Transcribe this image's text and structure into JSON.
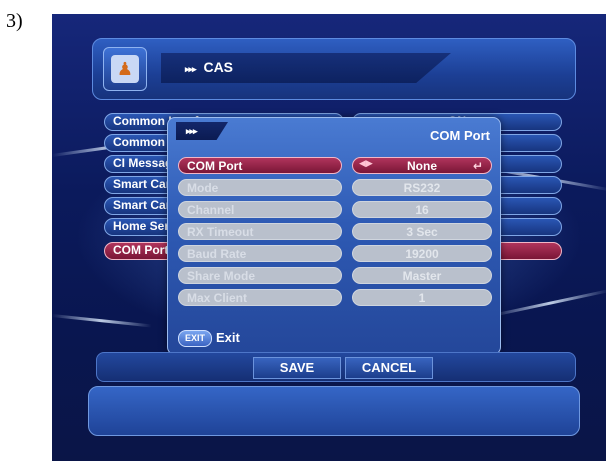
{
  "step_label": "3)",
  "header": {
    "arrows": "▸▸▸",
    "title": "CAS",
    "icon": "user-menu-icon"
  },
  "menu": {
    "items": [
      {
        "label": "Common Interface",
        "value": "ON"
      },
      {
        "label": "Common Interface",
        "value": ""
      },
      {
        "label": "CI Message",
        "value": ""
      },
      {
        "label": "Smart Card",
        "value": ""
      },
      {
        "label": "Smart Card",
        "value": ""
      },
      {
        "label": "Home Service",
        "value": ""
      },
      {
        "label": "COM Port",
        "value": ""
      }
    ]
  },
  "dialog": {
    "tab_arrows": "▸▸▸",
    "title": "COM Port",
    "rows": [
      {
        "label": "COM Port",
        "value": "None",
        "selected": true
      },
      {
        "label": "Mode",
        "value": "RS232"
      },
      {
        "label": "Channel",
        "value": "16"
      },
      {
        "label": "RX Timeout",
        "value": "3 Sec"
      },
      {
        "label": "Baud Rate",
        "value": "19200"
      },
      {
        "label": "Share Mode",
        "value": "Master"
      },
      {
        "label": "Max Client",
        "value": "1"
      }
    ],
    "exit_badge": "EXIT",
    "exit_label": "Exit"
  },
  "buttons": {
    "save": "SAVE",
    "cancel": "CANCEL"
  },
  "colors": {
    "selected": "#9a2448",
    "panel": "#2e5ab4",
    "background": "#0b1a5c"
  }
}
